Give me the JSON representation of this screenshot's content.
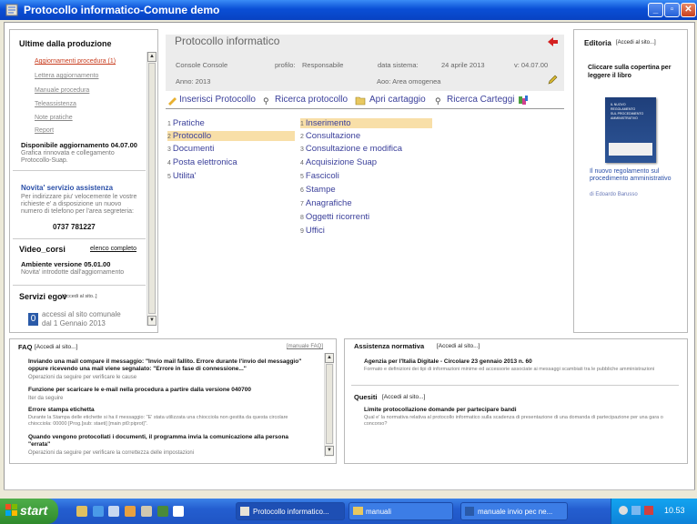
{
  "window": {
    "title": "Protocollo informatico-Comune demo"
  },
  "left_panel": {
    "section_title": "Ultime dalla produzione",
    "links": [
      {
        "label": "Aggiornamenti procedura (1)",
        "style": "red"
      },
      {
        "label": "Lettera aggiornamento",
        "style": "grey"
      },
      {
        "label": "Manuale procedura",
        "style": "grey"
      },
      {
        "label": "Teleassistenza",
        "style": "grey"
      },
      {
        "label": "Note pratiche",
        "style": "grey"
      },
      {
        "label": "Report",
        "style": "grey"
      }
    ],
    "update_title": "Disponibile aggiornamento 04.07.00",
    "update_text_1": "Grafica rinnovata e collegamento",
    "update_text_2": "Protocollo-Suap.",
    "assist_title": "Novita' servizio assistenza",
    "assist_text_1": "Per indirizzare piu' velocemente le vostre",
    "assist_text_2": "richieste e' a disposizione un nuovo",
    "assist_text_3": "numero di telefono per l'area segreteria:",
    "phone": "0737 781227",
    "video_title": "Video_corsi",
    "video_link": "elenco completo",
    "env_title": "Ambiente versione 05.01.00",
    "env_text": "Novita' introdotte dall'aggiornamento",
    "egov_title": "Servizi egov",
    "egov_link": "[Accedi al sito..]",
    "access_count": "0",
    "access_text_1": "accessi al sito comunale",
    "access_text_2": "dal 1 Gennaio 2013"
  },
  "header": {
    "title": "Protocollo informatico",
    "console": "Console Console",
    "profile_label": "profilo:",
    "profile_value": "Responsabile",
    "date_label": "data sistema:",
    "date_value": "24 aprile 2013",
    "version": "v: 04.07.00",
    "year": "Anno: 2013",
    "aoo": "Aoo: Area omogenea"
  },
  "toolbar": {
    "insert": "Inserisci Protocollo",
    "search": "Ricerca protocollo",
    "open_folder": "Apri cartaggio",
    "search_folders": "Ricerca Carteggi"
  },
  "main_menu": [
    {
      "num": "1",
      "label": "Pratiche"
    },
    {
      "num": "2",
      "label": "Protocollo"
    },
    {
      "num": "3",
      "label": "Documenti"
    },
    {
      "num": "4",
      "label": "Posta elettronica"
    },
    {
      "num": "5",
      "label": "Utilita'"
    }
  ],
  "sub_menu": [
    {
      "num": "1",
      "label": "Inserimento"
    },
    {
      "num": "2",
      "label": "Consultazione"
    },
    {
      "num": "3",
      "label": "Consultazione e modifica"
    },
    {
      "num": "4",
      "label": "Acquisizione Suap"
    },
    {
      "num": "5",
      "label": "Fascicoli"
    },
    {
      "num": "6",
      "label": "Stampe"
    },
    {
      "num": "7",
      "label": "Anagrafiche"
    },
    {
      "num": "8",
      "label": "Oggetti ricorrenti"
    },
    {
      "num": "9",
      "label": "Uffici"
    }
  ],
  "right_panel": {
    "title": "Editoria",
    "link": "[Accedi al sito...]",
    "cover_text": "Cliccare sulla copertina per leggere il libro",
    "book_title": "Il nuovo regolamento sul procedimento amministrativo",
    "book_author": "di Edoardo Barusso",
    "book_cover_lines": [
      "IL NUOVO",
      "REGOLAMENTO",
      "SUL PROCEDIMENTO",
      "AMMINISTRATIVO"
    ]
  },
  "faq": {
    "title": "FAQ",
    "link": "[Accedi al sito...]",
    "manual_link": "[manuale FAQ]",
    "items": [
      {
        "title": "Inviando una mail compare il messaggio: \"Invio mail fallito. Errore durante l'invio del messaggio\" oppure ricevendo una mail viene segnalato: \"Errore in fase di connessione...\"",
        "text": "Operazioni da seguire per verificare le cause"
      },
      {
        "title": "Funzione per scaricare le e-mail nella procedura a partire dalla versione 040700",
        "text": "Iter da seguire"
      },
      {
        "title": "Errore stampa etichetta",
        "text": "Durante la Stampa delle etichette si ha il messaggio: \"E' stata utilizzata una chiocciola non gestita da questa circolare chiocciola: 00000 [Prog.[sub: staeti] [main pt0:piprot]\"."
      },
      {
        "title": "Quando vengono protocollati i documenti, il programma invia la comunicazione alla persona \"errata\"",
        "text": "Operazioni da seguire per verificare la correttezza delle impostazioni"
      }
    ]
  },
  "assistenza": {
    "title": "Assistenza normativa",
    "link": "[Accedi al sito...]",
    "item_title": "Agenzia per l'Italia Digitale - Circolare 23 gennaio 2013 n. 60",
    "item_text": "Formato e definizioni dei tipi di informazioni minime ed accessorie associate ai messaggi scambiati tra le pubbliche amministrazioni",
    "quesiti_title": "Quesiti",
    "quesiti_link": "[Accedi al sito...]",
    "quesito_title": "Limite protocollazione domande per partecipare bandi",
    "quesito_text": "Qual e' la normativa relativa al protocollo informatico sulla scadenza di presentazione di una domanda di partecipazione per una gara o concorso?"
  },
  "taskbar": {
    "start": "start",
    "tasks": [
      "Protocollo informatico...",
      "manuali",
      "",
      "manuale invio pec ne..."
    ],
    "clock": "10.53"
  },
  "colors": {
    "titlebar": "#0a4fd6",
    "link_red": "#c83c1e",
    "menu_blue": "#3a3f9a",
    "highlight": "#f8dfa8",
    "taskbar": "#245ed0"
  }
}
